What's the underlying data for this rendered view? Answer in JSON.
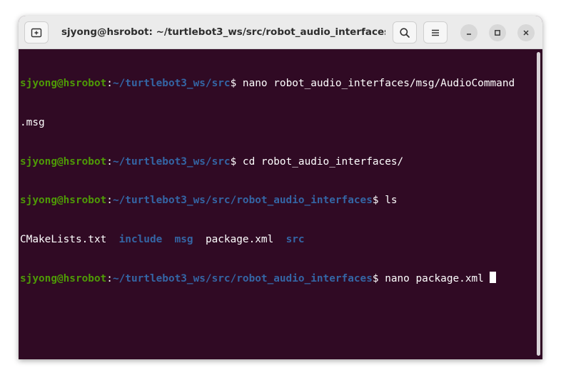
{
  "window": {
    "title": "sjyong@hsrobot: ~/turtlebot3_ws/src/robot_audio_interfaces"
  },
  "titlebar": {
    "new_tab_icon": "new-tab-icon",
    "search_icon": "search-icon",
    "menu_icon": "hamburger-menu-icon",
    "minimize_icon": "minimize-icon",
    "maximize_icon": "maximize-icon",
    "close_icon": "close-icon"
  },
  "terminal": {
    "user_host": "sjyong@hsrobot",
    "colors": {
      "background": "#300a24",
      "user": "#4e9a06",
      "path": "#3465a4",
      "text": "#ffffff"
    },
    "lines": [
      {
        "prompt_path": "~/turtlebot3_ws/src",
        "command": " nano robot_audio_interfaces/msg/AudioCommand"
      },
      {
        "continuation": ".msg"
      },
      {
        "prompt_path": "~/turtlebot3_ws/src",
        "command": " cd robot_audio_interfaces/"
      },
      {
        "prompt_path": "~/turtlebot3_ws/src/robot_audio_interfaces",
        "command": " ls"
      },
      {
        "ls_output": [
          "CMakeLists.txt",
          "include",
          "msg",
          "package.xml",
          "src"
        ]
      },
      {
        "prompt_path": "~/turtlebot3_ws/src/robot_audio_interfaces",
        "command": " nano package.xml "
      }
    ]
  }
}
